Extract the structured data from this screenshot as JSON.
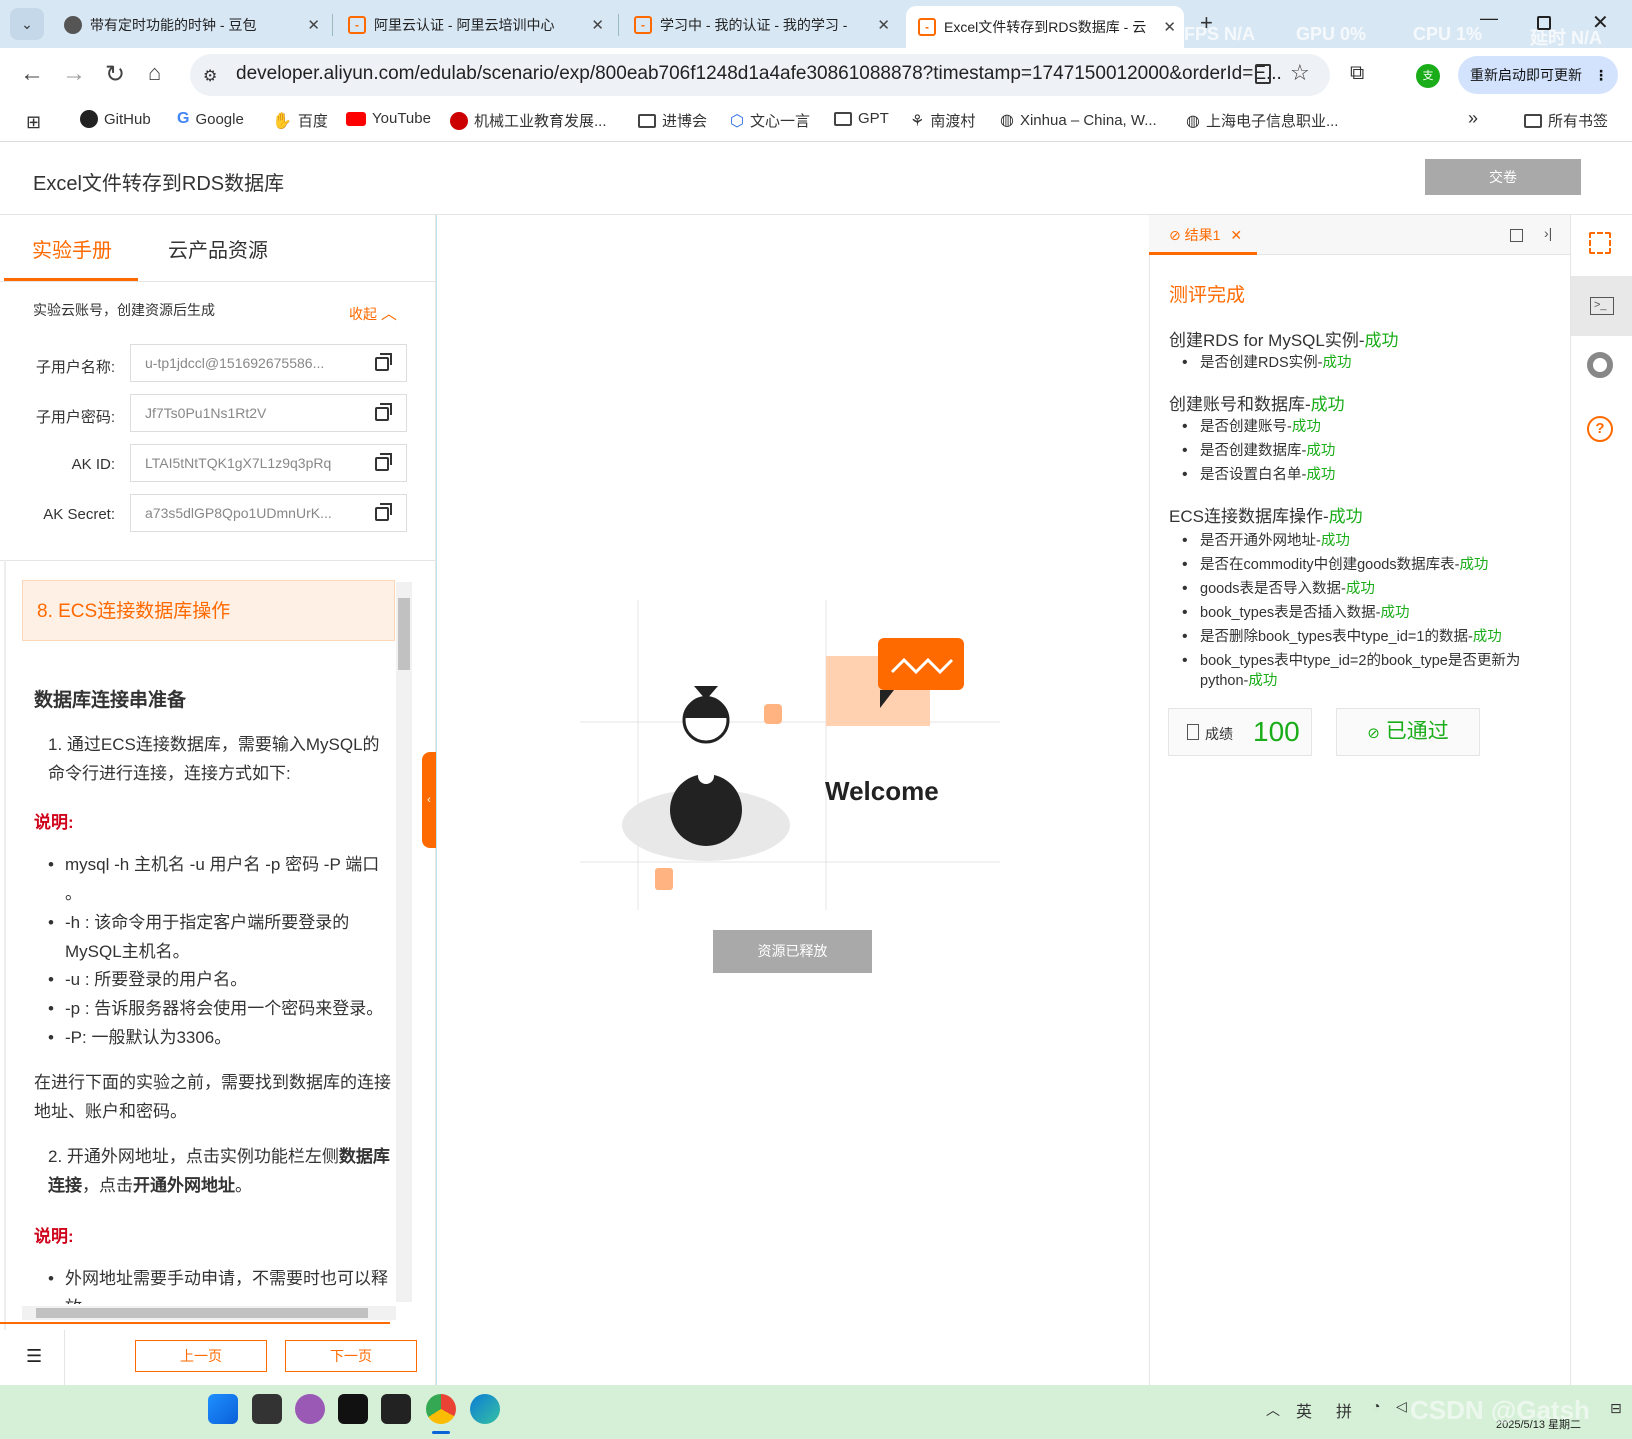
{
  "browser": {
    "tabs": [
      {
        "title": "带有定时功能的时钟 - 豆包"
      },
      {
        "title": "阿里云认证 - 阿里云培训中心"
      },
      {
        "title": "学习中 - 我的认证 - 我的学习 -"
      },
      {
        "title": "Excel文件转存到RDS数据库 - 云"
      }
    ],
    "overlay": {
      "fps": "FPS  N/A",
      "gpu": "GPU  0%",
      "cpu": "CPU  1%",
      "latency": "延时  N/A"
    },
    "url": "developer.aliyun.com/edulab/scenario/exp/800eab706f1248d1a4afe30861088878?timestamp=1747150012000&orderId=E...",
    "profile_letter": "支",
    "update_label": "重新启动即可更新",
    "bookmarks": [
      "GitHub",
      "Google",
      "百度",
      "YouTube",
      "机械工业教育发展...",
      "进博会",
      "文心一言",
      "GPT",
      "南渡村",
      "Xinhua – China, W...",
      "上海电子信息职业..."
    ],
    "all_bookmarks": "所有书签"
  },
  "page": {
    "title": "Excel文件转存到RDS数据库",
    "submit_label": "交卷",
    "tabs": [
      "实验手册",
      "云产品资源"
    ],
    "account_note": "实验云账号，创建资源后生成",
    "collapse": "收起",
    "fields": [
      {
        "label": "子用户名称:",
        "value": "u-tp1jdccl@151692675586..."
      },
      {
        "label": "子用户密码:",
        "value": "Jf7Ts0Pu1Ns1Rt2V"
      },
      {
        "label": "AK ID:",
        "value": "LTAI5tNtTQK1gX7L1z9q3pRq"
      },
      {
        "label": "AK Secret:",
        "value": "a73s5dlGP8Qpo1UDmnUrK..."
      }
    ],
    "section_title": "8. ECS连接数据库操作",
    "sub_heading": "数据库连接串准备",
    "step1": "1. 通过ECS连接数据库，需要输入MySQL的命令行进行连接，连接方式如下:",
    "note": "说明:",
    "bullets": [
      "mysql -h 主机名 -u 用户名 -p 密码 -P 端口 。",
      "-h : 该命令用于指定客户端所要登录的MySQL主机名。",
      "-u : 所要登录的用户名。",
      "-p : 告诉服务器将会使用一个密码来登录。",
      "-P:  一般默认为3306。"
    ],
    "para": "在进行下面的实验之前，需要找到数据库的连接地址、账户和密码。",
    "step2_a": "2. 开通外网地址，点击实例功能栏左侧",
    "step2_b": "数据库连接",
    "step2_c": "，点击",
    "step2_d": "开通外网地址",
    "step2_e": "。",
    "bullet_last": "外网地址需要手动申请，不需要时也可以释放",
    "prev": "上一页",
    "next": "下一页",
    "welcome": "Welcome",
    "released": "资源已释放"
  },
  "result": {
    "tab": "结果1",
    "status": "测评完成",
    "ok_word": "成功",
    "groups": [
      {
        "title": "创建RDS for MySQL实例-",
        "items": [
          "是否创建RDS实例-"
        ]
      },
      {
        "title": "创建账号和数据库-",
        "items": [
          "是否创建账号-",
          "是否创建数据库-",
          "是否设置白名单-"
        ]
      },
      {
        "title": "ECS连接数据库操作-",
        "items": [
          "是否开通外网地址-",
          "是否在commodity中创建goods数据库表-",
          "goods表是否导入数据-",
          "book_types表是否插入数据-",
          "是否删除book_types表中type_id=1的数据-",
          "book_types表中type_id=2的book_type是否更新为python-"
        ]
      }
    ],
    "score_label": "成绩",
    "score": "100",
    "passed": "已通过"
  },
  "taskbar": {
    "ime1": "英",
    "ime2": "拼",
    "date": "2025/5/13 星期二",
    "watermark": "CSDN @Gatsh"
  },
  "colors": {
    "accent": "#ff6a00",
    "success": "#1aad19"
  }
}
